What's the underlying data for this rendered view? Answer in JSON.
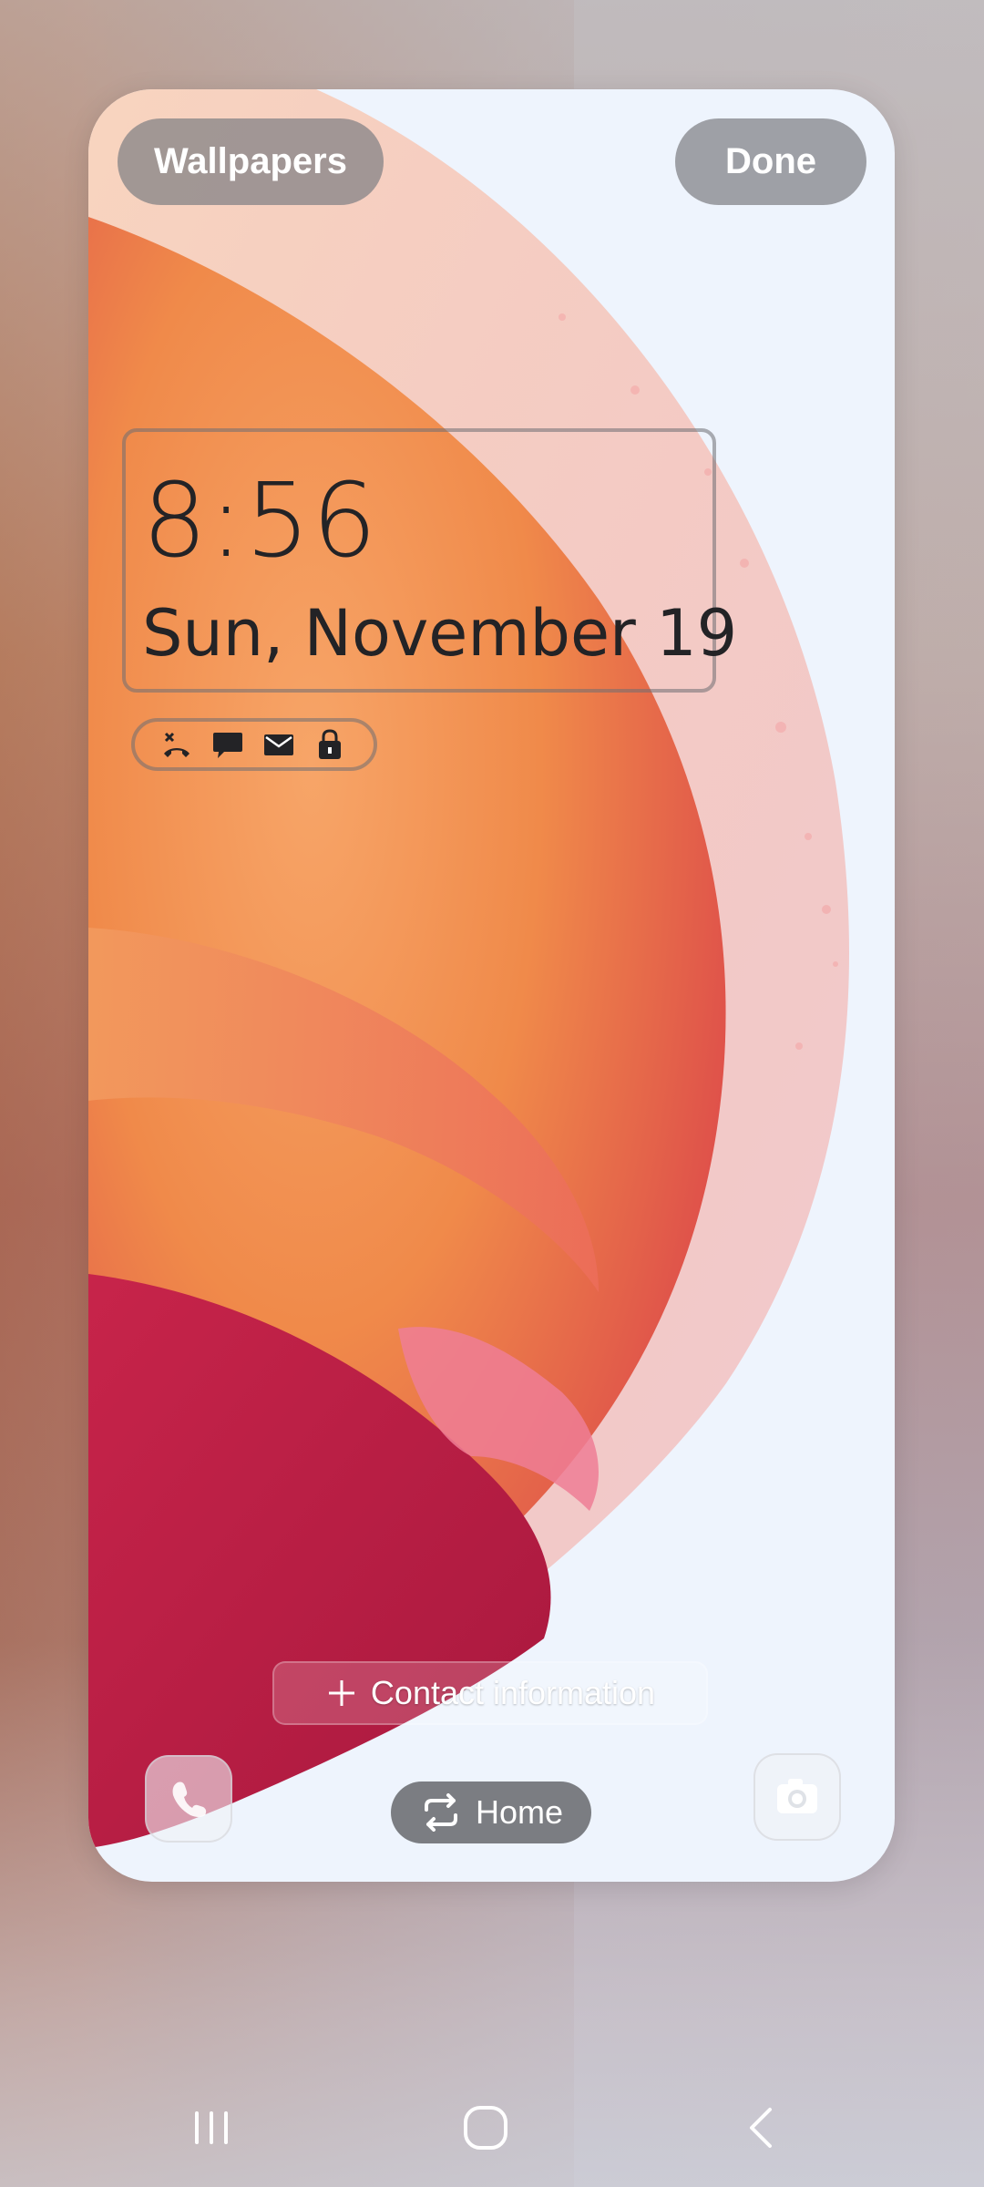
{
  "header": {
    "wallpapers_label": "Wallpapers",
    "done_label": "Done"
  },
  "lock_screen": {
    "time": "8:56",
    "date": "Sun, November 19",
    "notification_icons": [
      "missed-call-icon",
      "message-icon",
      "email-icon",
      "lock-icon"
    ],
    "contact_information_label": "Contact information",
    "left_shortcut_icon": "phone-icon",
    "right_shortcut_icon": "camera-icon",
    "toggle_label": "Home",
    "toggle_icon": "swap-icon"
  },
  "navbar": {
    "icons": [
      "recent-apps-icon",
      "home-icon",
      "back-icon"
    ]
  },
  "colors": {
    "button_bg": "#808084",
    "clock_text": "#232326",
    "wallpaper_base": "#eef4fd",
    "accent_orange": "#f08a4a",
    "accent_red": "#d93b4a"
  }
}
